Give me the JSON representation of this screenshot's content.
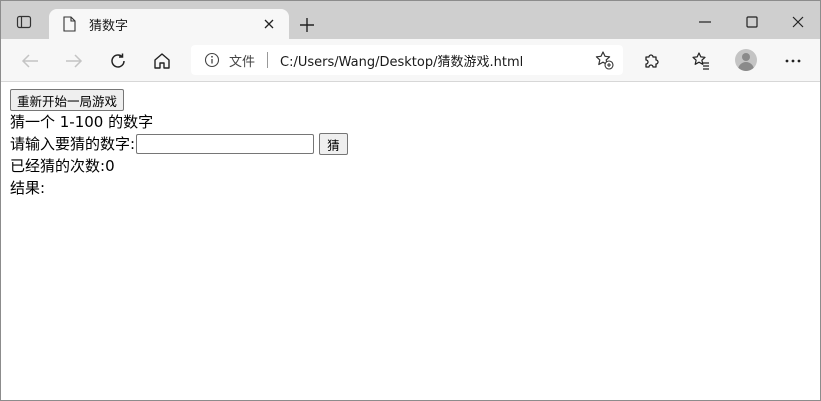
{
  "browser": {
    "tab": {
      "title": "猜数字"
    },
    "address_bar": {
      "scheme_label": "文件",
      "url": "C:/Users/Wang/Desktop/猜数游戏.html"
    }
  },
  "page": {
    "restart_button_label": "重新开始一局游戏",
    "prompt": "猜一个 1-100 的数字",
    "input_label": "请输入要猜的数字:",
    "input_value": "",
    "guess_button_label": "猜",
    "count_label": "已经猜的次数:",
    "count_value": "0",
    "result_label": "结果:",
    "result_value": ""
  },
  "icons": {
    "tab_actions": "tab-actions-icon",
    "page": "page-icon",
    "close": "close-icon",
    "new_tab": "plus-icon",
    "minimize": "minimize-icon",
    "maximize": "maximize-icon",
    "window_close": "close-icon",
    "back": "back-arrow-icon",
    "forward": "forward-arrow-icon",
    "refresh": "refresh-icon",
    "home": "home-icon",
    "info": "info-icon",
    "favorite_add": "star-add-icon",
    "extensions": "puzzle-icon",
    "favorites": "favorites-icon",
    "profile": "avatar-icon",
    "menu": "more-icon"
  }
}
